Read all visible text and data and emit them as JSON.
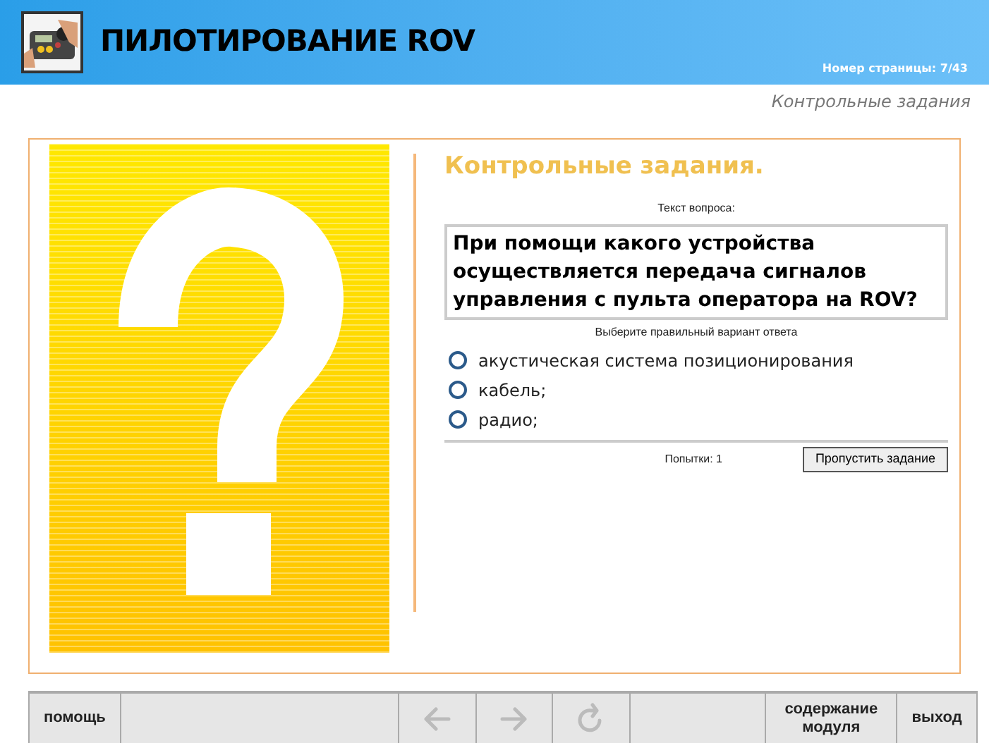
{
  "header": {
    "title": "ПИЛОТИРОВАНИЕ ROV",
    "page_number": "Номер страницы: 7/43"
  },
  "section_label": "Контрольные задания",
  "quiz": {
    "heading": "Контрольные задания.",
    "question_label": "Текст вопроса:",
    "question": "При помощи какого устройства осуществляется передача сигналов управления с пульта оператора на ROV?",
    "instruction": "Выберите правильный вариант ответа",
    "options": [
      {
        "label": "акустическая система позиционирования",
        "selected": false
      },
      {
        "label": "кабель;",
        "selected": false
      },
      {
        "label": "радио;",
        "selected": false
      }
    ],
    "attempts": "Попытки: 1",
    "skip_button": "Пропустить задание"
  },
  "nav": [
    {
      "kind": "label",
      "label": "помощь"
    },
    {
      "kind": "blank"
    },
    {
      "kind": "back",
      "disabled": true
    },
    {
      "kind": "forward",
      "disabled": true
    },
    {
      "kind": "reload",
      "disabled": true
    },
    {
      "kind": "blank"
    },
    {
      "kind": "label",
      "label": "содержание модуля"
    },
    {
      "kind": "label",
      "label": "выход"
    }
  ]
}
